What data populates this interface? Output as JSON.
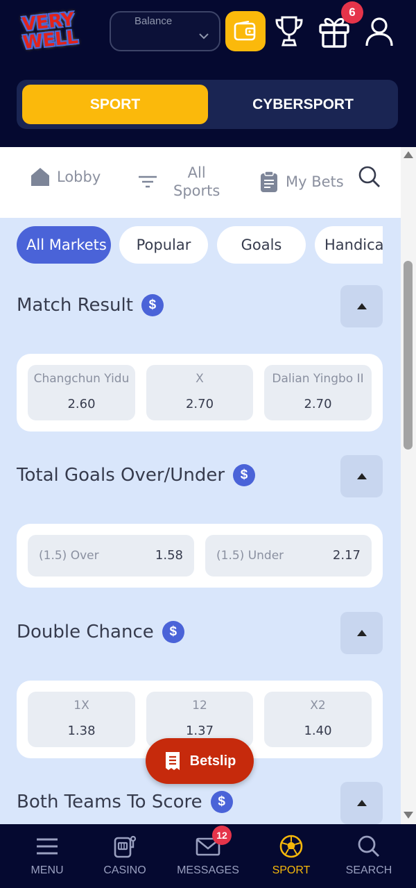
{
  "header": {
    "logo": {
      "line1": "VERY",
      "line2": "WELL"
    },
    "balance": {
      "label": "Balance"
    },
    "gift_badge": "6"
  },
  "switcher": {
    "sport": "SPORT",
    "cybersport": "CYBERSPORT"
  },
  "subnav": {
    "lobby": "Lobby",
    "all_sports_line1": "All",
    "all_sports_line2": "Sports",
    "my_bets": "My Bets"
  },
  "chips": [
    "All Markets",
    "Popular",
    "Goals",
    "Handicap"
  ],
  "sections": {
    "match_result": {
      "title": "Match Result",
      "odds": [
        {
          "name": "Changchun Yidu",
          "value": "2.60"
        },
        {
          "name": "X",
          "value": "2.70"
        },
        {
          "name": "Dalian Yingbo II",
          "value": "2.70"
        }
      ]
    },
    "total_goals": {
      "title": "Total Goals Over/Under",
      "odds": [
        {
          "name": "(1.5) Over",
          "value": "1.58"
        },
        {
          "name": "(1.5) Under",
          "value": "2.17"
        }
      ]
    },
    "double_chance": {
      "title": "Double Chance",
      "odds": [
        {
          "name": "1X",
          "value": "1.38"
        },
        {
          "name": "12",
          "value": "1.37"
        },
        {
          "name": "X2",
          "value": "1.40"
        }
      ]
    },
    "btts": {
      "title": "Both Teams To Score"
    }
  },
  "dollar_symbol": "$",
  "betslip": {
    "label": "Betslip"
  },
  "bottom_nav": {
    "menu": "MENU",
    "casino": "CASINO",
    "messages": "MESSAGES",
    "messages_badge": "12",
    "sport": "SPORT",
    "search": "SEARCH"
  },
  "colors": {
    "header_bg": "#050930",
    "accent_yellow": "#fbb90b",
    "accent_blue": "#4a63d8",
    "content_bg": "#d9e6fb",
    "betslip_red": "#c62a0c",
    "badge_red": "#e5344a"
  },
  "icons": [
    "wallet-icon",
    "trophy-icon",
    "gift-icon",
    "user-icon",
    "home-icon",
    "filter-icon",
    "clipboard-icon",
    "search-icon",
    "dollar-icon",
    "chevron-up-icon",
    "receipt-icon",
    "menu-icon",
    "slot-machine-icon",
    "mail-icon",
    "soccer-ball-icon"
  ]
}
